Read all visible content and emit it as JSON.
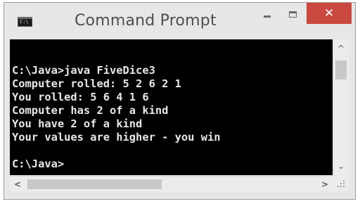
{
  "window": {
    "title": "Command Prompt",
    "icon": "cmd-icon",
    "icon_text": "C:\\",
    "controls": {
      "minimize": "minimize-icon",
      "maximize": "maximize-icon",
      "close_label": "✕"
    },
    "close_color": "#c9483f"
  },
  "console": {
    "lines": [
      "",
      "C:\\Java>java FiveDice3",
      "Computer rolled: 5 2 6 2 1",
      "You rolled: 5 6 4 1 6",
      "Computer has 2 of a kind",
      "You have 2 of a kind",
      "Your values are higher - you win",
      "",
      "C:\\Java>"
    ]
  },
  "scrollbars": {
    "up_arrow": "^",
    "down_arrow": "⌄",
    "left_arrow": "<",
    "right_arrow": ">"
  }
}
